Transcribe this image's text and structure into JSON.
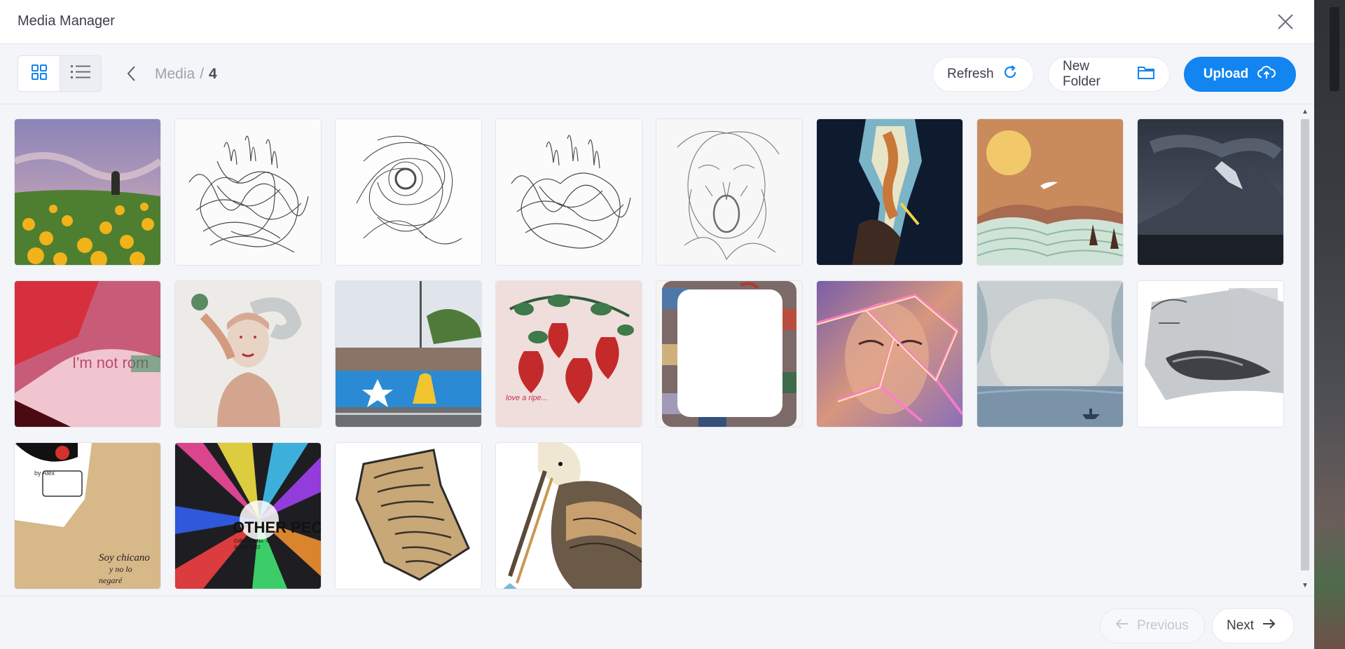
{
  "header": {
    "title": "Media Manager"
  },
  "toolbar": {
    "breadcrumb": {
      "root": "Media",
      "separator": "/",
      "current": "4"
    },
    "refresh_label": "Refresh",
    "new_folder_label": "New Folder",
    "upload_label": "Upload"
  },
  "footer": {
    "previous_label": "Previous",
    "next_label": "Next"
  },
  "colors": {
    "accent": "#1385f0",
    "text": "#3d4048",
    "muted": "#9ea2ab"
  },
  "icons": [
    "close-icon",
    "grid-view-icon",
    "list-view-icon",
    "chevron-left-icon",
    "refresh-icon",
    "folder-icon",
    "cloud-upload-icon",
    "arrow-left-icon",
    "arrow-right-icon"
  ],
  "media": {
    "tile_texts": {
      "im_not": "I'm not rom",
      "strawberry_caption": "love a ripe...",
      "chicano_title": "Soy chicano",
      "chicano_sub": "y no lo",
      "chicano_sub2": "negaré",
      "other_people": "OTHER PEOP",
      "collection": "Collection No. 4",
      "spring": "Spring 2022"
    }
  }
}
